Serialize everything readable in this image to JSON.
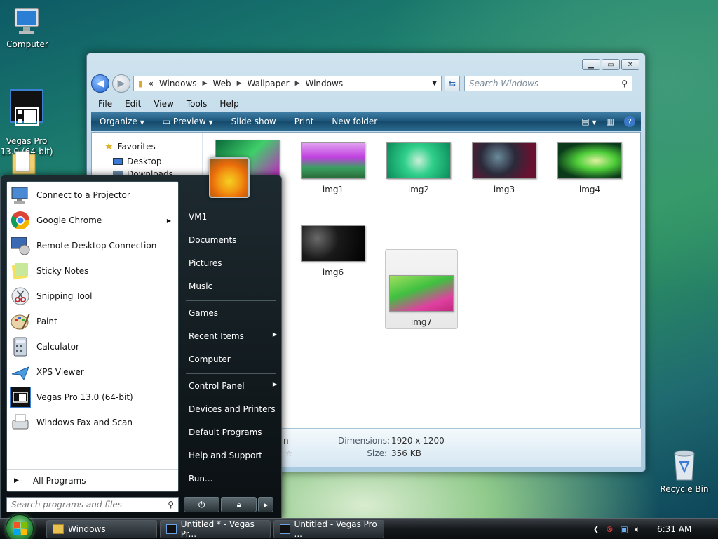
{
  "desktop": {
    "icons": [
      {
        "label": "Computer"
      },
      {
        "label": "Vegas Pro\n13.0 (64-bit)"
      },
      {
        "label": "Recycle Bin"
      }
    ]
  },
  "explorer": {
    "breadcrumb": {
      "prefix": "«",
      "parts": [
        "Windows",
        "Web",
        "Wallpaper",
        "Windows"
      ]
    },
    "search_placeholder": "Search Windows",
    "menu": [
      "File",
      "Edit",
      "View",
      "Tools",
      "Help"
    ],
    "commands": [
      "Organize",
      "Preview",
      "Slide show",
      "Print",
      "New folder"
    ],
    "nav": [
      {
        "label": "Favorites"
      },
      {
        "label": "Desktop"
      },
      {
        "label": "Downloads"
      }
    ],
    "thumbnails": [
      {
        "label": "img1"
      },
      {
        "label": "img2"
      },
      {
        "label": "img3"
      },
      {
        "label": "img4"
      },
      {
        "label": "img6"
      },
      {
        "label": "img7"
      }
    ],
    "details": {
      "dimensions_label": "Dimensions:",
      "dimensions_value": "1920 x 1200",
      "size_label": "Size:",
      "size_value": "356 KB",
      "partial_text": "n"
    }
  },
  "start_menu": {
    "programs": [
      {
        "label": "Connect to a Projector",
        "has_submenu": false
      },
      {
        "label": "Google Chrome",
        "has_submenu": true
      },
      {
        "label": "Remote Desktop Connection",
        "has_submenu": false
      },
      {
        "label": "Sticky Notes",
        "has_submenu": false
      },
      {
        "label": "Snipping Tool",
        "has_submenu": false
      },
      {
        "label": "Paint",
        "has_submenu": false
      },
      {
        "label": "Calculator",
        "has_submenu": false
      },
      {
        "label": "XPS Viewer",
        "has_submenu": false
      },
      {
        "label": "Vegas Pro 13.0 (64-bit)",
        "has_submenu": false
      },
      {
        "label": "Windows Fax and Scan",
        "has_submenu": false
      }
    ],
    "all_programs": "All Programs",
    "search_placeholder": "Search programs and files",
    "right_items": [
      {
        "label": "VM1"
      },
      {
        "label": "Documents"
      },
      {
        "label": "Pictures"
      },
      {
        "label": "Music"
      },
      {
        "label": "Games"
      },
      {
        "label": "Recent Items"
      },
      {
        "label": "Computer"
      },
      {
        "label": "Control Panel"
      },
      {
        "label": "Devices and Printers"
      },
      {
        "label": "Default Programs"
      },
      {
        "label": "Help and Support"
      },
      {
        "label": "Run..."
      }
    ]
  },
  "taskbar": {
    "buttons": [
      {
        "label": "Windows"
      },
      {
        "label": "Untitled * - Vegas Pr..."
      },
      {
        "label": "Untitled - Vegas Pro ..."
      }
    ],
    "clock": "6:31 AM"
  }
}
